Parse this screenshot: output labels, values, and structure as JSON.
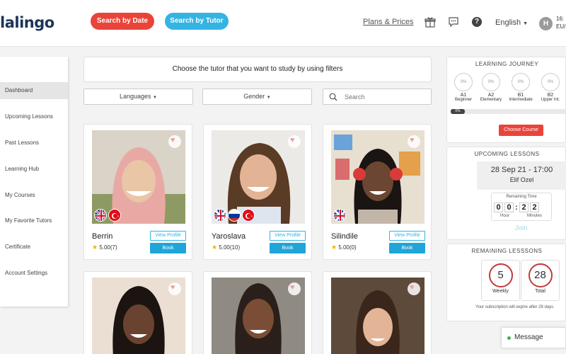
{
  "header": {
    "logo": "lalingo",
    "search_by_date": "Search by Date",
    "search_by_tutor": "Search by Tutor",
    "plans_link": "Plans & Prices",
    "gift_icon": "gift-icon",
    "chat_icon": "chat-icon",
    "help_label": "?",
    "language": "English",
    "avatar_initial": "H",
    "time_line1": "16:",
    "time_line2": "EU/"
  },
  "sidebar": {
    "items": [
      {
        "label": "Dashboard",
        "active": true
      },
      {
        "label": "Upcoming Lessons"
      },
      {
        "label": "Past Lessons"
      },
      {
        "label": "Learning Hub"
      },
      {
        "label": "My Courses"
      },
      {
        "label": "My Favorite Tutors"
      },
      {
        "label": "Certificate"
      },
      {
        "label": "Account Settings"
      }
    ]
  },
  "filters": {
    "title": "Choose the tutor that you want to study by using filters",
    "languages": "Languages",
    "gender": "Gender",
    "search_placeholder": "Search"
  },
  "tutors": [
    {
      "name": "Berrin",
      "rating": "5.00(7)",
      "view": "View Profile",
      "book": "Book",
      "flags": [
        "uk",
        "tr"
      ]
    },
    {
      "name": "Yaroslava",
      "rating": "5.00(10)",
      "view": "View Profile",
      "book": "Book",
      "flags": [
        "uk",
        "ru",
        "tr"
      ]
    },
    {
      "name": "Silindile",
      "rating": "5.00(0)",
      "view": "View Profile",
      "book": "Book",
      "flags": [
        "uk"
      ]
    }
  ],
  "journey": {
    "title": "LEARNING JOURNEY",
    "levels": [
      {
        "code": "A1",
        "name": "Beginner",
        "pct": "0%"
      },
      {
        "code": "A2",
        "name": "Elementary",
        "pct": "0%"
      },
      {
        "code": "B1",
        "name": "Intermediate",
        "pct": "0%"
      },
      {
        "code": "B2",
        "name": "Upper Int.",
        "pct": "0%"
      }
    ],
    "progress": "0%",
    "choose_button": "Choose Course"
  },
  "upcoming": {
    "title": "UPCOMING LESSONS",
    "date": "28 Sep 21 - 17:00",
    "tutor": "Elif Ozel",
    "remaining_label": "Remaining Time",
    "digits": [
      "0",
      "0",
      "2",
      "2"
    ],
    "hour_label": "Hour",
    "minutes_label": "Minutes",
    "join": "Join"
  },
  "remaining": {
    "title": "REMAINING LESSSONS",
    "weekly_value": "5",
    "weekly_label": "Weekly",
    "total_value": "28",
    "total_label": "Total",
    "expire_text": "Your subscription will expire after 28 days"
  },
  "message": {
    "label": "Message"
  }
}
